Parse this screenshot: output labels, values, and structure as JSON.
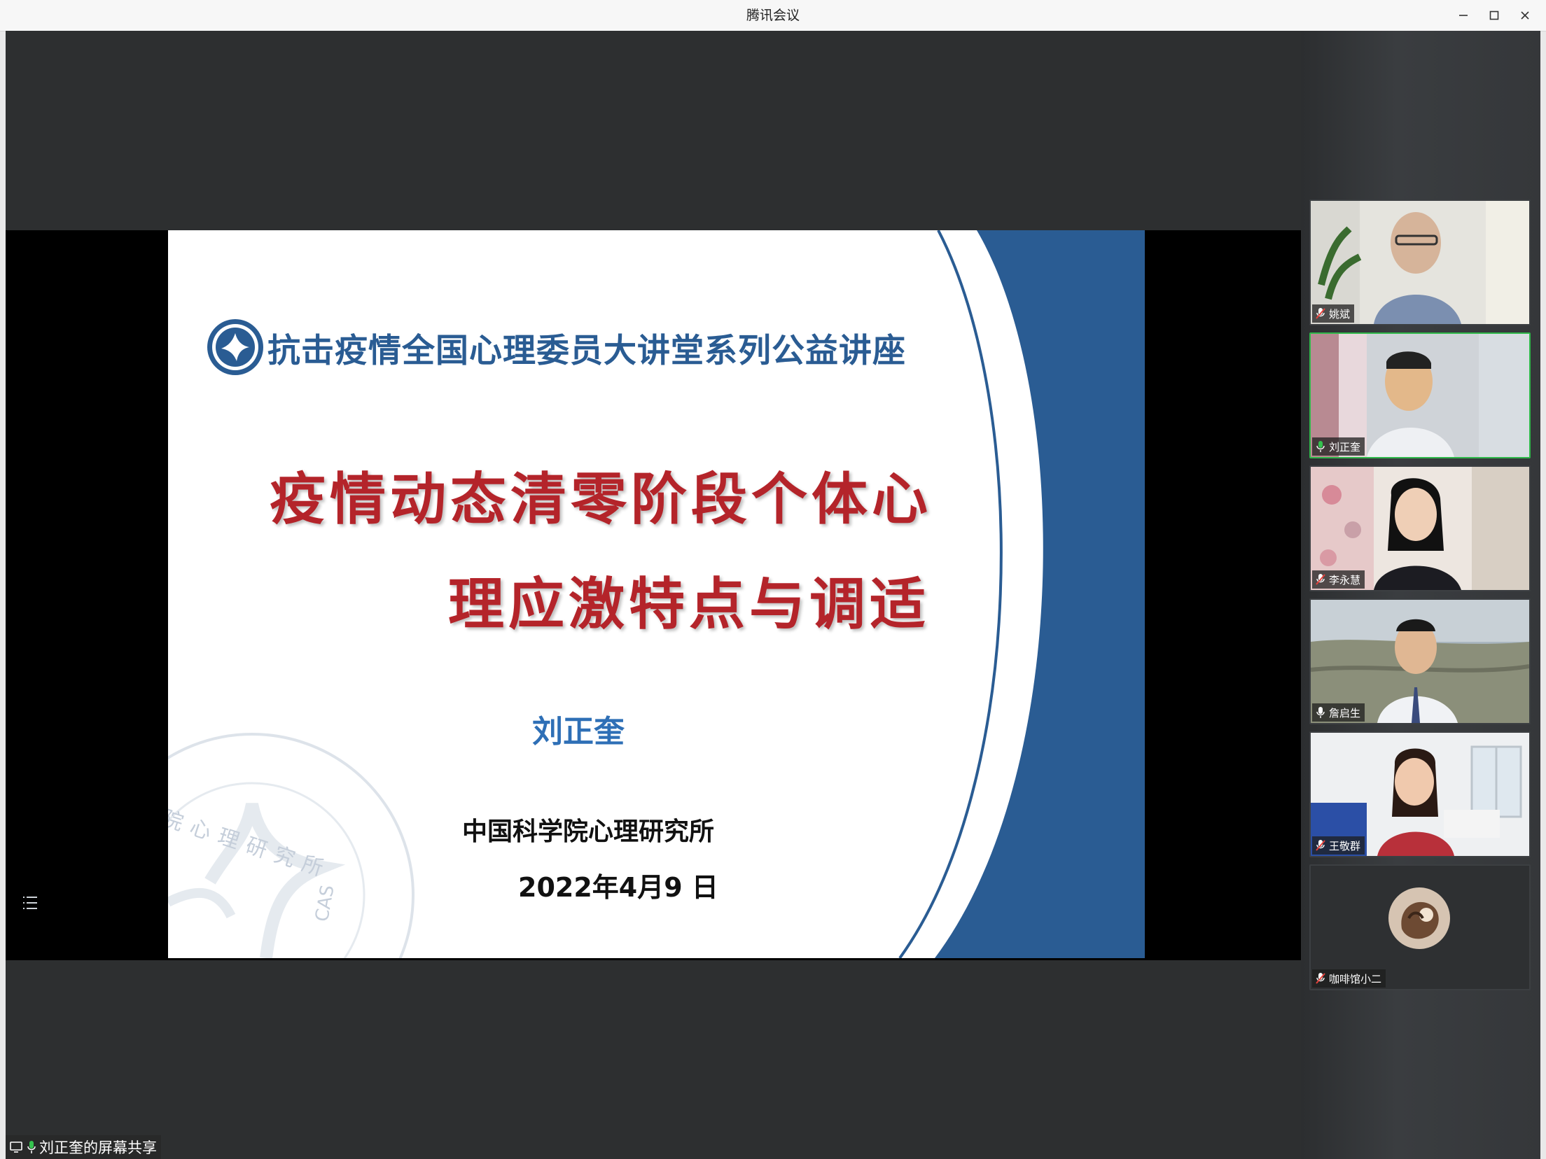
{
  "window": {
    "title": "腾讯会议"
  },
  "slide": {
    "header": "抗击疫情全国心理委员大讲堂系列公益讲座",
    "title_line1": "疫情动态清零阶段个体心",
    "title_line2": "理应激特点与调适",
    "author": "刘正奎",
    "organization": "中国科学院心理研究所",
    "date": "2022年4月9 日",
    "watermark_text": "院心理研究所",
    "watermark_cas": "CAS"
  },
  "share_badge": {
    "label": "刘正奎的屏幕共享"
  },
  "participants": [
    {
      "name": "姚斌",
      "mic": "muted",
      "active": false
    },
    {
      "name": "刘正奎",
      "mic": "on",
      "active": true
    },
    {
      "name": "李永慧",
      "mic": "muted",
      "active": false
    },
    {
      "name": "詹启生",
      "mic": "on",
      "active": false
    },
    {
      "name": "王敬群",
      "mic": "muted",
      "active": false
    },
    {
      "name": "咖啡馆小二",
      "mic": "muted",
      "active": false
    }
  ],
  "colors": {
    "slide_blue": "#2a5c93",
    "slide_red": "#b4242a",
    "speaking_border": "#2fb84a"
  }
}
